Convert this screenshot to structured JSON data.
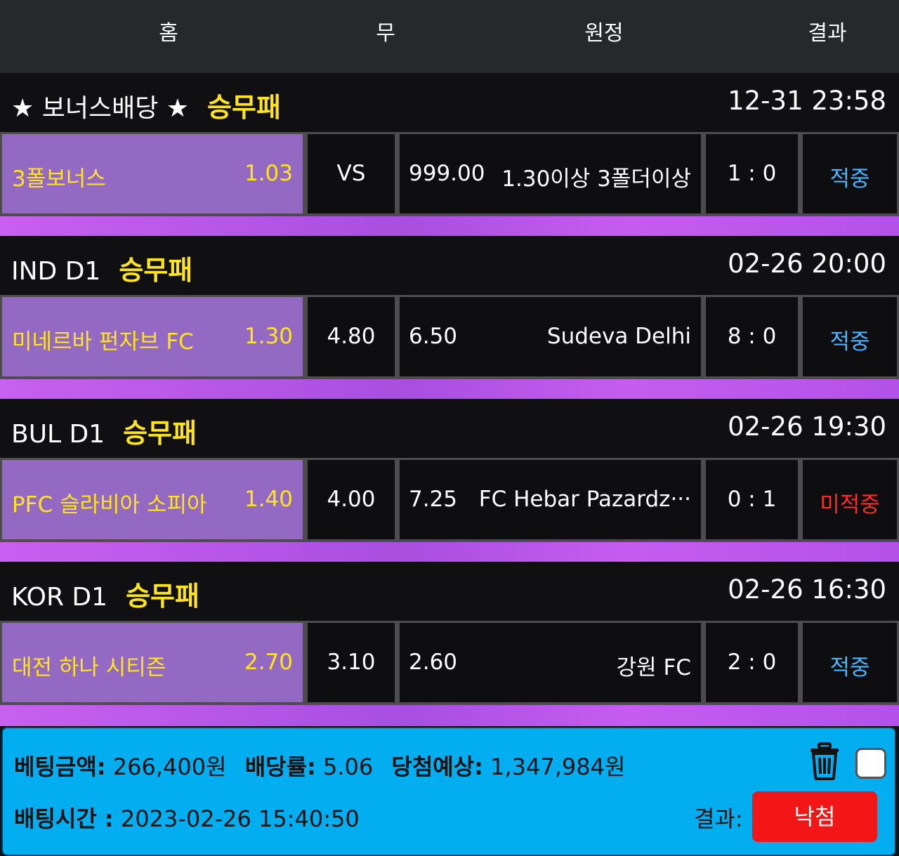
{
  "header": {
    "home": "홈",
    "draw": "무",
    "away": "원정",
    "result": "결과"
  },
  "matches": [
    {
      "league": "★ 보너스배당 ★",
      "type": "승무패",
      "datetime": "12-31 23:58",
      "home_name": "3폴보너스",
      "home_odds": "1.03",
      "draw": "VS",
      "away_odds": "999.00",
      "away_name": "1.30이상 3폴더이상",
      "score": "1 : 0",
      "result": "적중"
    },
    {
      "league": "IND D1",
      "type": "승무패",
      "datetime": "02-26 20:00",
      "home_name": "미네르바 펀자브 FC",
      "home_odds": "1.30",
      "draw": "4.80",
      "away_odds": "6.50",
      "away_name": "Sudeva Delhi",
      "score": "8 : 0",
      "result": "적중"
    },
    {
      "league": "BUL D1",
      "type": "승무패",
      "datetime": "02-26 19:30",
      "home_name": "PFC 슬라비아 소피아",
      "home_odds": "1.40",
      "draw": "4.00",
      "away_odds": "7.25",
      "away_name": "FC Hebar Pazardz···",
      "score": "0 : 1",
      "result": "미적중"
    },
    {
      "league": "KOR D1",
      "type": "승무패",
      "datetime": "02-26 16:30",
      "home_name": "대전 하나 시티즌",
      "home_odds": "2.70",
      "draw": "3.10",
      "away_odds": "2.60",
      "away_name": "강원 FC",
      "score": "2 : 0",
      "result": "적중"
    }
  ],
  "summary": {
    "bet_amount_label": "베팅금액:",
    "bet_amount": "266,400원",
    "odds_label": "배당률:",
    "odds": "5.06",
    "expected_label": "당첨예상:",
    "expected": "1,347,984원",
    "bet_time_label": "배팅시간 :",
    "bet_time": "2023-02-26 15:40:50",
    "result_label": "결과:",
    "result_value": "낙첨"
  },
  "colors": {
    "hit": "#4ab6ff",
    "miss": "#ff2a2a",
    "accent_yellow": "#ffe51a",
    "home_cell": "#9469c3",
    "footer_bg": "#02aef0",
    "result_button": "#f31616"
  },
  "icons": {
    "trash": "trash-icon",
    "checkbox": "checkbox"
  }
}
